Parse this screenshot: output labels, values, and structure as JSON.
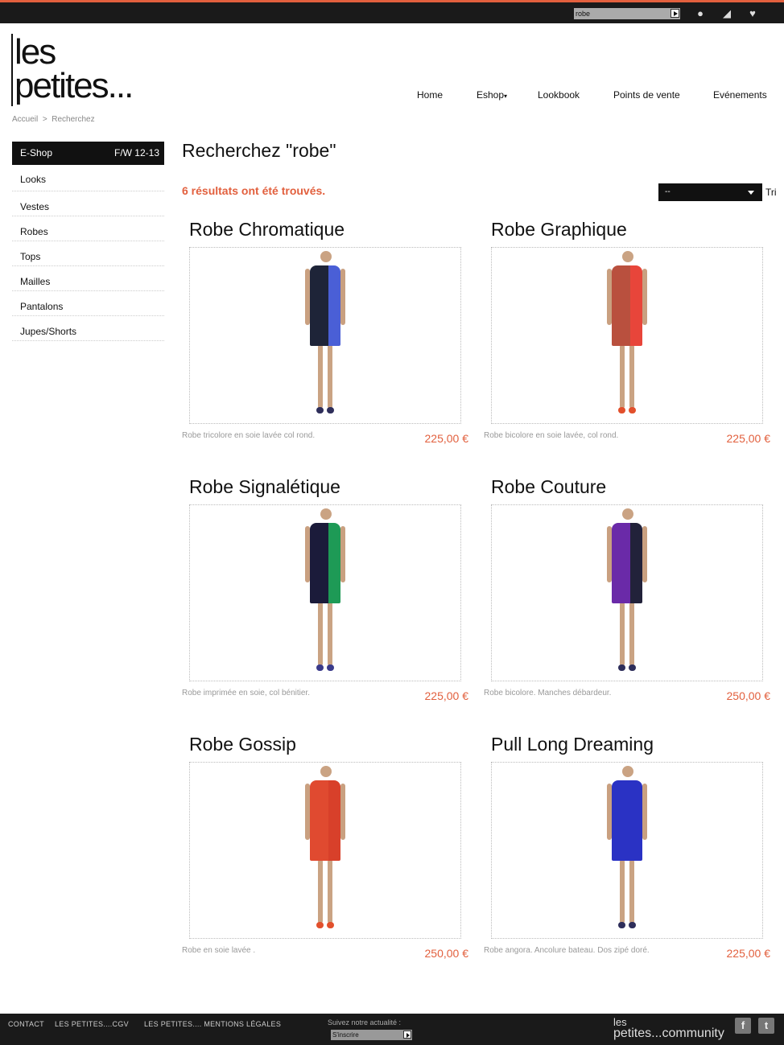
{
  "accent": "#e2603e",
  "topbar": {
    "search_value": "robe",
    "icons": [
      "user-icon",
      "basket-icon",
      "heart-icon"
    ]
  },
  "logo": {
    "line1": "les",
    "line2": "petites..."
  },
  "nav": [
    "Home",
    "Eshop",
    "Lookbook",
    "Points de vente",
    "Evénements"
  ],
  "breadcrumb": {
    "home": "Accueil",
    "sep": ">",
    "current": "Recherchez"
  },
  "sidebar": {
    "title": "E-Shop",
    "season": "F/W 12-13",
    "items": [
      "Looks",
      "Vestes",
      "Robes",
      "Tops",
      "Mailles",
      "Pantalons",
      "Jupes/Shorts"
    ]
  },
  "main": {
    "title": "Recherchez \"robe\"",
    "result_count": "6 résultats ont été trouvés.",
    "sort_value": "--",
    "sort_label": "Tri"
  },
  "products": [
    {
      "title": "Robe Chromatique",
      "desc": "Robe tricolore en soie lavée col rond.",
      "price": "225,00 €",
      "colors": [
        "#1e2438",
        "#4a5fd6"
      ],
      "shoes": "#2e2e5a"
    },
    {
      "title": "Robe Graphique",
      "desc": "Robe bicolore en soie lavée, col rond.",
      "price": "225,00 €",
      "colors": [
        "#b9503e",
        "#e8453a"
      ],
      "shoes": "#e2502c"
    },
    {
      "title": "Robe Signalétique",
      "desc": "Robe imprimée en soie, col bénitier.",
      "price": "225,00 €",
      "colors": [
        "#1b1b3a",
        "#1e9a56"
      ],
      "shoes": "#3a3a8a"
    },
    {
      "title": "Robe Couture",
      "desc": "Robe bicolore. Manches débardeur.",
      "price": "250,00 €",
      "colors": [
        "#6a2aa8",
        "#22223a"
      ],
      "shoes": "#2e2e5a"
    },
    {
      "title": "Robe Gossip",
      "desc": "Robe en soie lavée .",
      "price": "250,00 €",
      "colors": [
        "#e04a30",
        "#d8402a"
      ],
      "shoes": "#e2502c"
    },
    {
      "title": "Pull Long Dreaming",
      "desc": "Robe angora. Ancolure bateau. Dos zipé doré.",
      "price": "225,00 €",
      "colors": [
        "#2a32c4",
        "#2a32c4"
      ],
      "shoes": "#2e2e5a"
    }
  ],
  "footer": {
    "links": [
      "CONTACT",
      "LES PETITES....CGV",
      "LES PETITES.... MENTIONS LÉGALES"
    ],
    "follow_label": "Suivez notre actualité :",
    "signup_value": "S'inscrire",
    "community_line1": "les",
    "community_line2": "petites...community",
    "social": [
      "facebook-icon",
      "twitter-icon"
    ]
  }
}
